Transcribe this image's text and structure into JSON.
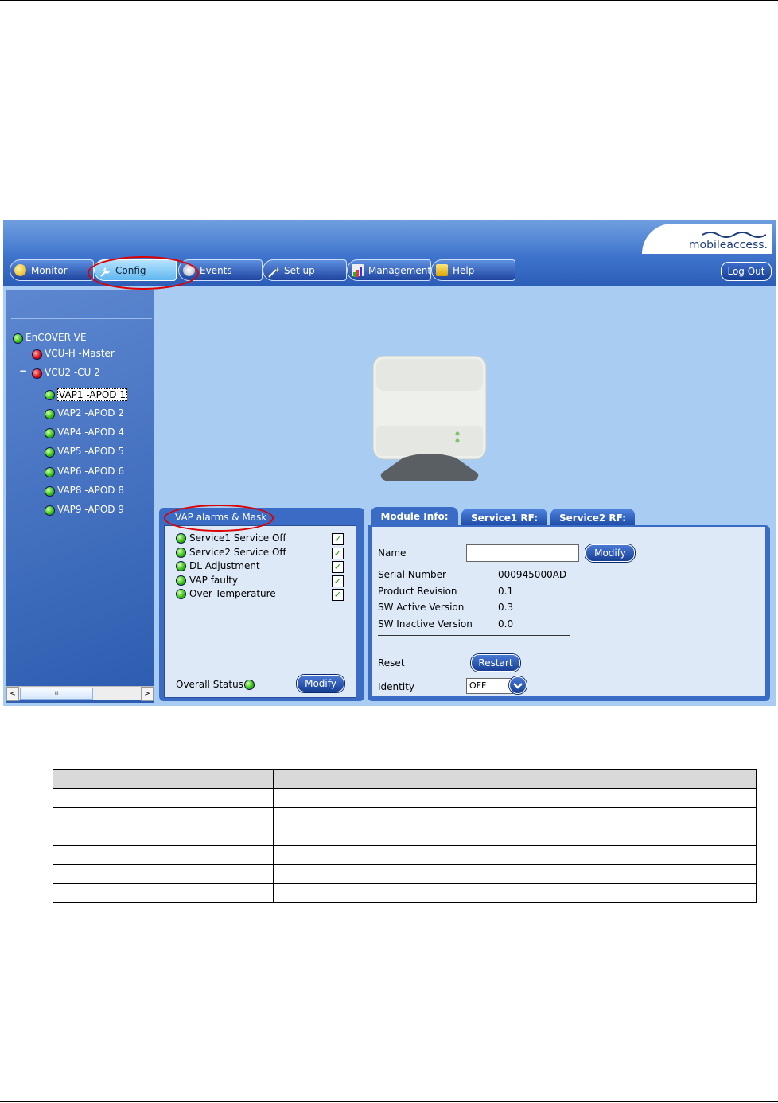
{
  "app": {
    "logo_text": "mobileaccess.",
    "tabs": [
      {
        "label": "Monitor",
        "icon": "monitor-icon"
      },
      {
        "label": "Config",
        "icon": "wrench-icon"
      },
      {
        "label": "Events",
        "icon": "events-icon"
      },
      {
        "label": "Set up",
        "icon": "setup-wand-icon"
      },
      {
        "label": "Management",
        "icon": "management-chart-icon"
      },
      {
        "label": "Help",
        "icon": "help-book-icon"
      }
    ],
    "active_tab": "Config",
    "logout_label": "Log Out"
  },
  "tree": {
    "items": [
      {
        "label": "EnCOVER VE",
        "status": "green",
        "expander": ""
      },
      {
        "label": "VCU-H -Master",
        "status": "red",
        "expander": ""
      },
      {
        "label": "VCU2 -CU 2",
        "status": "red",
        "expander": "−"
      },
      {
        "label": "VAP1 -APOD 1",
        "status": "green",
        "expander": "",
        "selected": true
      },
      {
        "label": "VAP2 -APOD 2",
        "status": "green",
        "expander": ""
      },
      {
        "label": "VAP4 -APOD 4",
        "status": "green",
        "expander": ""
      },
      {
        "label": "VAP5 -APOD 5",
        "status": "green",
        "expander": ""
      },
      {
        "label": "VAP6 -APOD 6",
        "status": "green",
        "expander": ""
      },
      {
        "label": "VAP8 -APOD 8",
        "status": "green",
        "expander": ""
      },
      {
        "label": "VAP9 -APOD 9",
        "status": "green",
        "expander": ""
      }
    ],
    "scrollbar_grip": "III"
  },
  "alarms": {
    "title": "VAP alarms & Mask",
    "items": [
      {
        "label": "Service1 Service Off",
        "status": "green",
        "checked": true
      },
      {
        "label": "Service2 Service Off",
        "status": "green",
        "checked": true
      },
      {
        "label": "DL Adjustment",
        "status": "green",
        "checked": true
      },
      {
        "label": "VAP faulty",
        "status": "green",
        "checked": true
      },
      {
        "label": "Over Temperature",
        "status": "green",
        "checked": true
      }
    ],
    "check_mark": "✓",
    "overall_label": "Overall Status",
    "overall_status": "green",
    "modify_label": "Modify"
  },
  "module": {
    "tabs": [
      "Module Info:",
      "Service1 RF:",
      "Service2 RF:"
    ],
    "name_label": "Name",
    "name_value": "",
    "modify_label": "Modify",
    "fields": [
      {
        "label": "Serial Number",
        "value": "000945000AD"
      },
      {
        "label": "Product Revision",
        "value": "0.1"
      },
      {
        "label": "SW Active Version",
        "value": "0.3"
      },
      {
        "label": "SW Inactive Version",
        "value": "0.0"
      }
    ],
    "reset_label": "Reset",
    "restart_label": "Restart",
    "identity_label": "Identity",
    "identity_value": "OFF"
  },
  "colors": {
    "accent": "#3b6cc5",
    "highlight_circle": "#dd0000",
    "status_green": "#36c410",
    "status_red": "#e01010"
  }
}
